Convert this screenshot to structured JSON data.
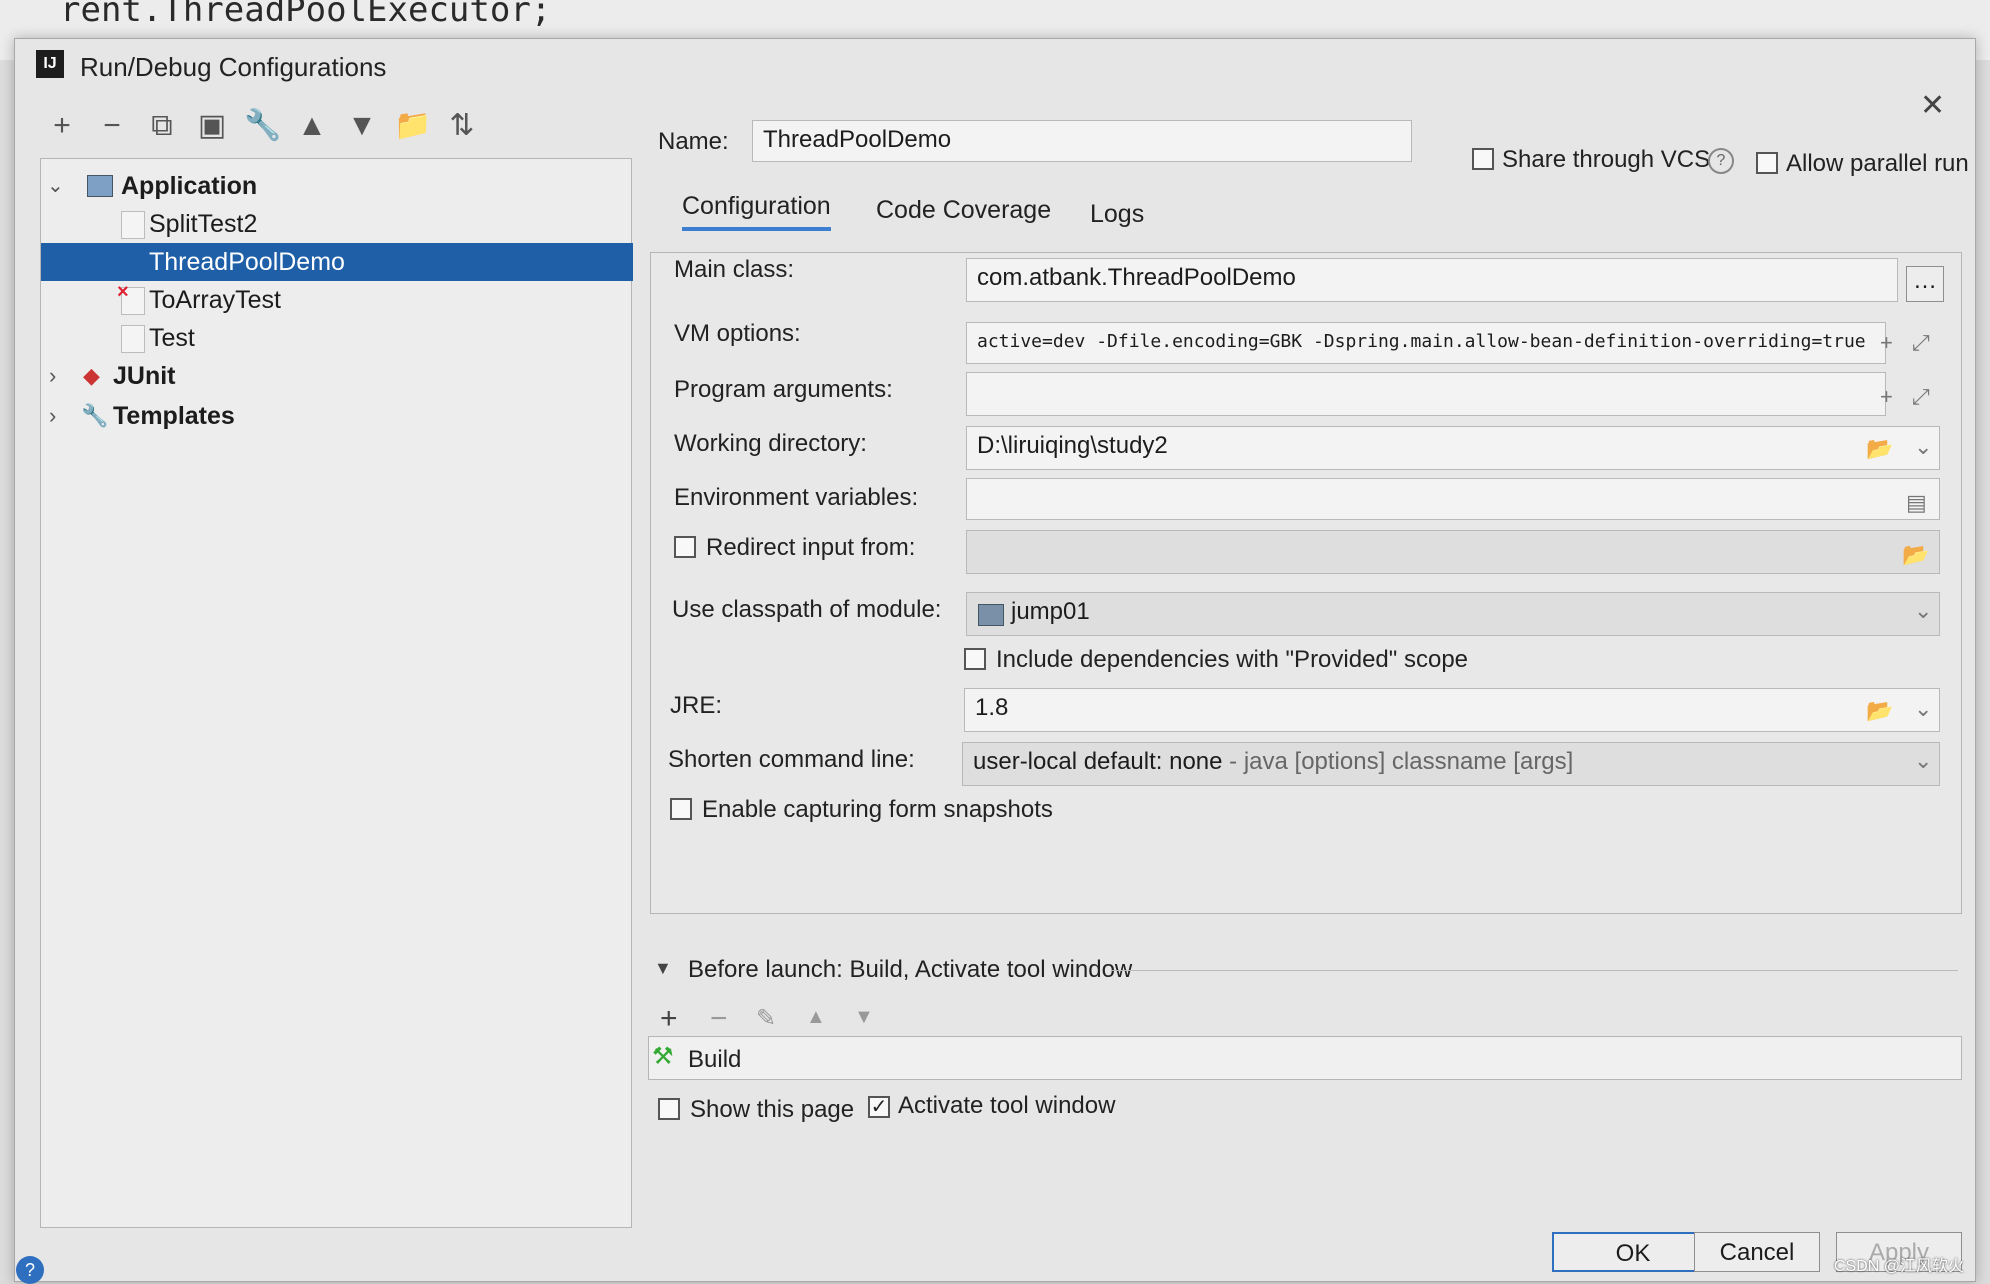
{
  "background": {
    "code_line": "rent.ThreadPoolExecutor;"
  },
  "window": {
    "title": "Run/Debug Configurations",
    "app_icon": "IJ"
  },
  "toolbar": [
    {
      "name": "add-icon",
      "glyph": "+"
    },
    {
      "name": "remove-icon",
      "glyph": "−"
    },
    {
      "name": "copy-icon",
      "glyph": "⧉"
    },
    {
      "name": "save-icon",
      "glyph": "▣"
    },
    {
      "name": "wrench-icon",
      "glyph": "🔧"
    },
    {
      "name": "move-up-icon",
      "glyph": "▲"
    },
    {
      "name": "move-down-icon",
      "glyph": "▼"
    },
    {
      "name": "folder-icon",
      "glyph": "📁"
    },
    {
      "name": "sort-icon",
      "glyph": "⇅"
    }
  ],
  "tree": {
    "application": "Application",
    "items": [
      "SplitTest2",
      "ThreadPoolDemo",
      "ToArrayTest",
      "Test"
    ],
    "junit": "JUnit",
    "templates": "Templates"
  },
  "header": {
    "name_label": "Name:",
    "name_value": "ThreadPoolDemo",
    "share_label": "Share through VCS",
    "allow_parallel": "Allow parallel run"
  },
  "tabs": [
    "Configuration",
    "Code Coverage",
    "Logs"
  ],
  "config": {
    "main_class_label": "Main class:",
    "main_class_value": "com.atbank.ThreadPoolDemo",
    "vm_label": "VM options:",
    "vm_value": "active=dev -Dfile.encoding=GBK  -Dspring.main.allow-bean-definition-overriding=true",
    "args_label": "Program arguments:",
    "args_value": "",
    "wd_label": "Working directory:",
    "wd_value": "D:\\liruiqing\\study2",
    "env_label": "Environment variables:",
    "env_value": "",
    "redirect_label": "Redirect input from:",
    "classpath_label": "Use classpath of module:",
    "classpath_value": "jump01",
    "include_deps": "Include dependencies with \"Provided\" scope",
    "jre_label": "JRE:",
    "jre_value": "1.8",
    "shorten_label": "Shorten command line:",
    "shorten_value": "user-local default: none",
    "shorten_hint": " - java [options] classname [args]",
    "snapshots_label": "Enable capturing form snapshots"
  },
  "before_launch": {
    "header": "Before launch: Build, Activate tool window",
    "item": "Build",
    "show_page": "Show this page",
    "activate_tool": "Activate tool window"
  },
  "buttons": {
    "ok": "OK",
    "cancel": "Cancel",
    "apply": "Apply"
  },
  "watermark": "CSDN @江风软火",
  "colors": {
    "selection": "#1f5fa8",
    "accent": "#3c7fd0"
  }
}
